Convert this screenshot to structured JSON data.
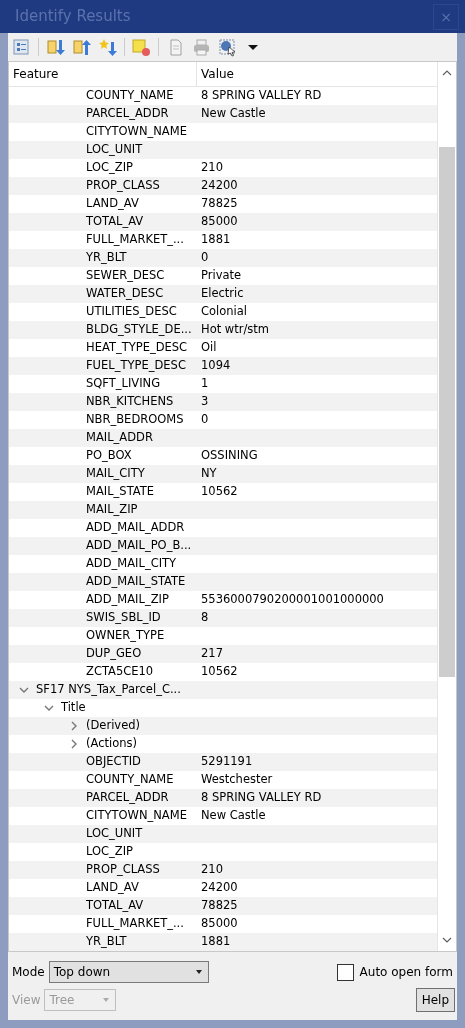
{
  "window": {
    "title": "Identify Results",
    "close": "×"
  },
  "columns": [
    "Feature",
    "Value"
  ],
  "tree": [
    {
      "kind": "hidden",
      "children": [
        {
          "kind": "hidden",
          "children": [
            {
              "kind": "attribute",
              "feature": "COUNTY_NAME",
              "value": "8 SPRING VALLEY RD"
            },
            {
              "kind": "attribute",
              "feature": "PARCEL_ADDR",
              "value": "New Castle"
            },
            {
              "kind": "attribute",
              "feature": "CITYTOWN_NAME"
            },
            {
              "kind": "attribute",
              "feature": "LOC_UNIT"
            },
            {
              "kind": "attribute",
              "feature": "LOC_ZIP",
              "value": "210"
            },
            {
              "kind": "attribute",
              "feature": "PROP_CLASS",
              "value": "24200"
            },
            {
              "kind": "attribute",
              "feature": "LAND_AV",
              "value": "78825"
            },
            {
              "kind": "attribute",
              "feature": "TOTAL_AV",
              "value": "85000"
            },
            {
              "kind": "attribute",
              "feature": "FULL_MARKET_...",
              "value": "1881"
            },
            {
              "kind": "attribute",
              "feature": "YR_BLT",
              "value": "0"
            },
            {
              "kind": "attribute",
              "feature": "SEWER_DESC",
              "value": "Private"
            },
            {
              "kind": "attribute",
              "feature": "WATER_DESC",
              "value": "Electric"
            },
            {
              "kind": "attribute",
              "feature": "UTILITIES_DESC",
              "value": "Colonial"
            },
            {
              "kind": "attribute",
              "feature": "BLDG_STYLE_DE...",
              "value": "Hot wtr/stm"
            },
            {
              "kind": "attribute",
              "feature": "HEAT_TYPE_DESC",
              "value": "Oil"
            },
            {
              "kind": "attribute",
              "feature": "FUEL_TYPE_DESC",
              "value": "1094"
            },
            {
              "kind": "attribute",
              "feature": "SQFT_LIVING",
              "value": "1"
            },
            {
              "kind": "attribute",
              "feature": "NBR_KITCHENS",
              "value": "3"
            },
            {
              "kind": "attribute",
              "feature": "NBR_BEDROOMS",
              "value": "0"
            },
            {
              "kind": "attribute",
              "feature": "MAIL_ADDR"
            },
            {
              "kind": "attribute",
              "feature": "PO_BOX",
              "value": "OSSINING"
            },
            {
              "kind": "attribute",
              "feature": "MAIL_CITY",
              "value": "NY"
            },
            {
              "kind": "attribute",
              "feature": "MAIL_STATE",
              "value": "10562"
            },
            {
              "kind": "attribute",
              "feature": "MAIL_ZIP"
            },
            {
              "kind": "attribute",
              "feature": "ADD_MAIL_ADDR"
            },
            {
              "kind": "attribute",
              "feature": "ADD_MAIL_PO_B..."
            },
            {
              "kind": "attribute",
              "feature": "ADD_MAIL_CITY"
            },
            {
              "kind": "attribute",
              "feature": "ADD_MAIL_STATE"
            },
            {
              "kind": "attribute",
              "feature": "ADD_MAIL_ZIP",
              "value": "5536000790200001001000000"
            },
            {
              "kind": "attribute",
              "feature": "SWIS_SBL_ID",
              "value": "8"
            },
            {
              "kind": "attribute",
              "feature": "OWNER_TYPE"
            },
            {
              "kind": "attribute",
              "feature": "DUP_GEO",
              "value": "217"
            },
            {
              "kind": "attribute",
              "feature": "ZCTA5CE10",
              "value": "10562"
            }
          ]
        }
      ]
    },
    {
      "kind": "node",
      "label": "SF17 NYS_Tax_Parcel_C...",
      "expanded": true,
      "children": [
        {
          "kind": "node",
          "label": "Title",
          "expanded": true,
          "children": [
            {
              "kind": "node",
              "label": "(Derived)",
              "expanded": false
            },
            {
              "kind": "node",
              "label": "(Actions)",
              "expanded": false
            },
            {
              "kind": "attribute",
              "feature": "OBJECTID",
              "value": "5291191"
            },
            {
              "kind": "attribute",
              "feature": "COUNTY_NAME",
              "value": "Westchester"
            },
            {
              "kind": "attribute",
              "feature": "PARCEL_ADDR",
              "value": "8 SPRING VALLEY RD"
            },
            {
              "kind": "attribute",
              "feature": "CITYTOWN_NAME",
              "value": "New Castle"
            },
            {
              "kind": "attribute",
              "feature": "LOC_UNIT"
            },
            {
              "kind": "attribute",
              "feature": "LOC_ZIP"
            },
            {
              "kind": "attribute",
              "feature": "PROP_CLASS",
              "value": "210"
            },
            {
              "kind": "attribute",
              "feature": "LAND_AV",
              "value": "24200"
            },
            {
              "kind": "attribute",
              "feature": "TOTAL_AV",
              "value": "78825"
            },
            {
              "kind": "attribute",
              "feature": "FULL_MARKET_...",
              "value": "85000"
            },
            {
              "kind": "attribute",
              "feature": "YR_BLT",
              "value": "1881"
            }
          ]
        }
      ]
    }
  ],
  "mode": {
    "label": "Mode",
    "value": "Top down"
  },
  "auto_open": {
    "label": "Auto open form",
    "checked": false
  },
  "view": {
    "label": "View",
    "value": "Tree",
    "disabled": true
  },
  "help": "Help"
}
